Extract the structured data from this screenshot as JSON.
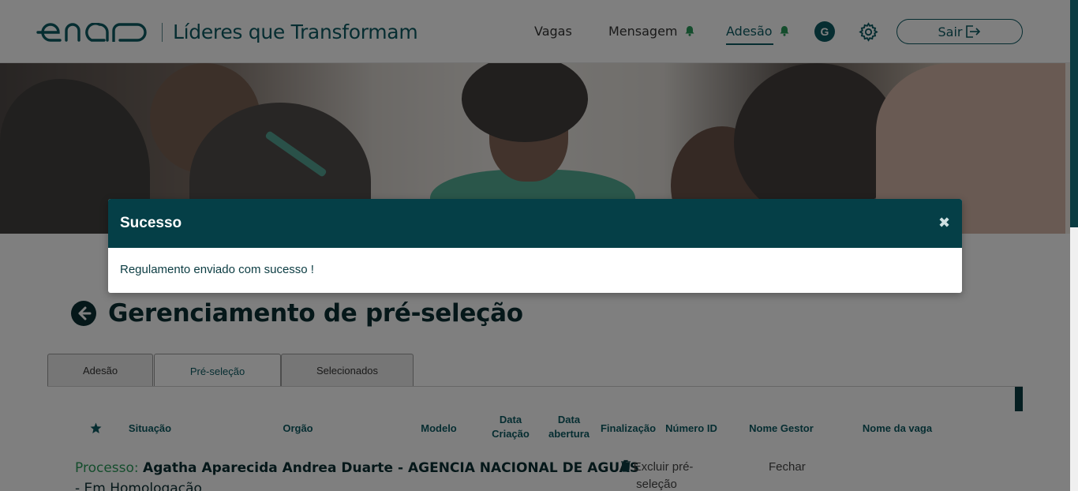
{
  "header": {
    "brand_logo": "enap",
    "brand_title": "Líderes que Transformam",
    "nav": {
      "vagas": "Vagas",
      "mensagem": "Mensagem",
      "adesao": "Adesão"
    },
    "avatar_initial": "G",
    "logout_label": "Sair"
  },
  "page": {
    "title": "Gerenciamento de pré-seleção",
    "tabs": [
      "Adesão",
      "Pré-seleção",
      "Selecionados"
    ],
    "active_tab": "Pré-seleção"
  },
  "table": {
    "columns": {
      "situacao": "Situação",
      "orgao": "Orgão",
      "modelo": "Modelo",
      "data_criacao": "Data Criação",
      "data_abertura": "Data abertura",
      "finalizacao": "Finalização",
      "numero_id": "Número ID",
      "nome_gestor": "Nome Gestor",
      "nome_vaga": "Nome da vaga"
    },
    "row": {
      "process_label": "Processo:",
      "process_name": "Agatha Aparecida Andrea Duarte - AGENCIA NACIONAL DE AGUAS",
      "status": "- Em Homologação",
      "delete_label": "Excluir pré-seleção",
      "close_label": "Fechar"
    }
  },
  "modal": {
    "title": "Sucesso",
    "close_glyph": "✖",
    "message": "Regulamento enviado com sucesso !"
  },
  "colors": {
    "primary": "#0c5a63",
    "modal_header": "#053f47",
    "process_label": "#2a9a5a"
  },
  "icons": [
    "bell-icon",
    "gear-icon",
    "logout-icon",
    "back-arrow-icon",
    "star-icon",
    "trash-icon",
    "close-icon"
  ]
}
